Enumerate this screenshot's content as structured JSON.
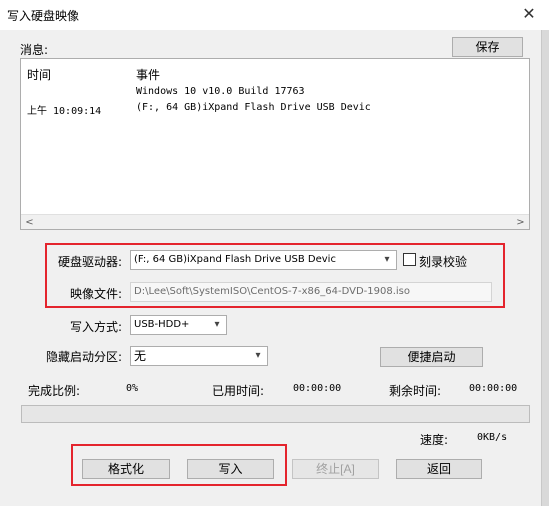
{
  "window": {
    "title": "写入硬盘映像",
    "close_glyph": "✕"
  },
  "messages": {
    "label": "消息:",
    "save_button": "保存",
    "col_time": "时间",
    "col_event": "事件",
    "rows": [
      {
        "time": "",
        "event": "Windows 10 v10.0 Build 17763"
      },
      {
        "time": "上午 10:09:14",
        "event": "(F:, 64 GB)iXpand Flash Drive USB Devic"
      }
    ],
    "scroll_left": "<",
    "scroll_right": ">"
  },
  "drive": {
    "label": "硬盘驱动器:",
    "selected": "(F:, 64 GB)iXpand Flash Drive USB Devic",
    "verify_label": "刻录校验",
    "verify_checked": false
  },
  "image_file": {
    "label": "映像文件:",
    "value": "D:\\Lee\\Soft\\SystemISO\\CentOS-7-x86_64-DVD-1908.iso"
  },
  "write_method": {
    "label": "写入方式:",
    "selected": "USB-HDD+"
  },
  "hide_partition": {
    "label": "隐藏启动分区:",
    "selected": "无",
    "quick_start_button": "便捷启动"
  },
  "status": {
    "percent_label": "完成比例:",
    "percent_value": "0%",
    "elapsed_label": "已用时间:",
    "elapsed_value": "00:00:00",
    "remaining_label": "剩余时间:",
    "remaining_value": "00:00:00",
    "progress": 0,
    "speed_label": "速度:",
    "speed_value": "0KB/s"
  },
  "actions": {
    "format": "格式化",
    "write": "写入",
    "stop": "终止[A]",
    "back": "返回"
  },
  "colors": {
    "highlight_border": "#e4242d",
    "window_bg": "#f0f0f0"
  }
}
